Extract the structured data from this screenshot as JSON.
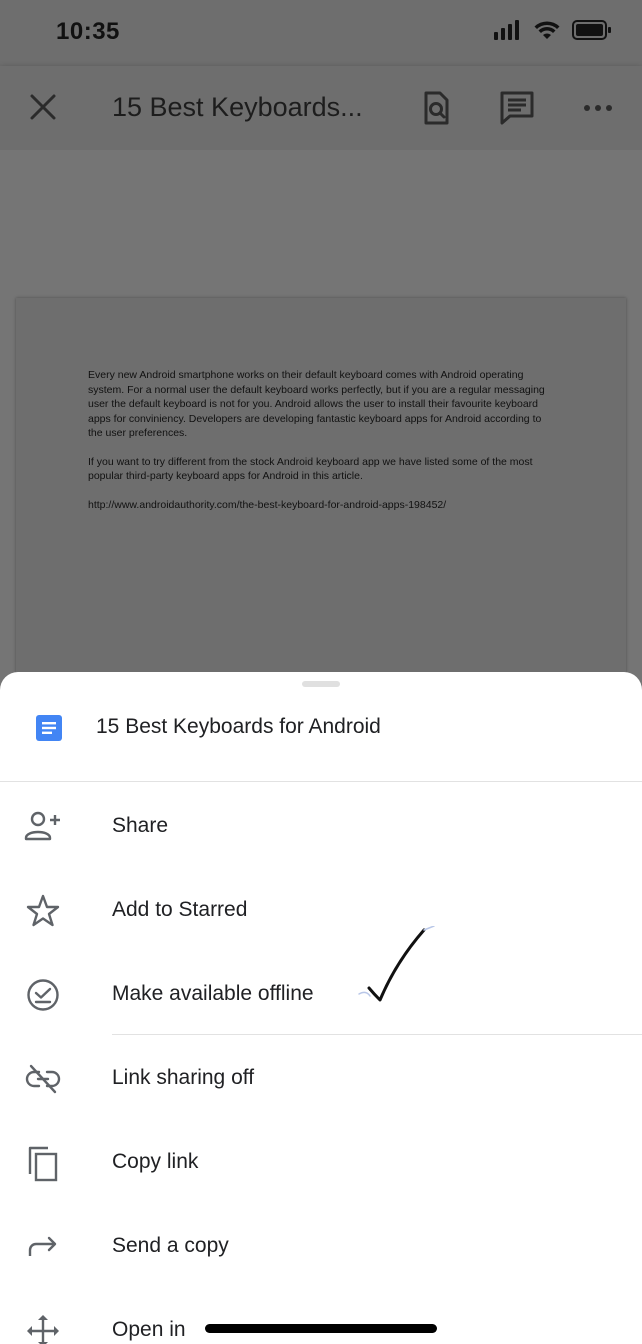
{
  "status_bar": {
    "time": "10:35"
  },
  "app_bar": {
    "title": "15 Best Keyboards...",
    "close_icon": "close-icon",
    "find_icon": "find-in-page-icon",
    "comment_icon": "comment-icon",
    "more_icon": "more-horiz-icon"
  },
  "document": {
    "paragraphs": [
      "Every new Android smartphone works on their default keyboard comes with Android operating system. For a normal user the default keyboard works perfectly, but if you are a regular messaging user the default keyboard is not for you. Android allows the user to install their favourite keyboard apps for conviniency. Developers are developing fantastic keyboard apps for Android according to the user preferences.",
      "If you want to try different from the stock Android keyboard app we have listed some of the most popular third-party keyboard apps for Android in this article.",
      "http://www.androidauthority.com/the-best-keyboard-for-android-apps-198452/"
    ]
  },
  "sheet": {
    "file_name": "15 Best Keyboards for Android",
    "doc_icon_color": "#4285f4",
    "items": [
      {
        "label": "Share",
        "icon": "add-person-icon"
      },
      {
        "label": "Add to Starred",
        "icon": "star-outline-icon"
      },
      {
        "label": "Make available offline",
        "icon": "offline-check-icon"
      },
      {
        "label": "Link sharing off",
        "icon": "link-off-icon"
      },
      {
        "label": "Copy link",
        "icon": "copy-icon"
      },
      {
        "label": "Send a copy",
        "icon": "forward-arrow-icon"
      },
      {
        "label": "Open in",
        "icon": "open-in-move-icon"
      }
    ]
  }
}
